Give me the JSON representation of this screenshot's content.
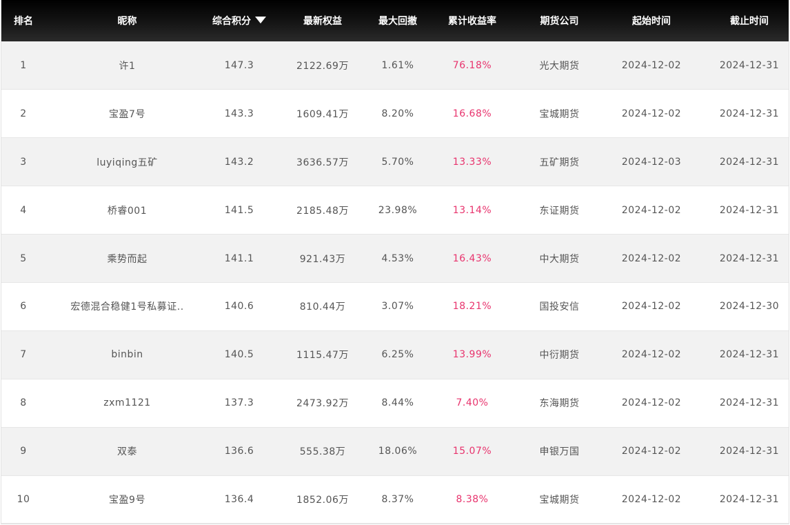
{
  "table": {
    "headers": {
      "rank": "排名",
      "nickname": "昵称",
      "score": "综合积分",
      "equity": "最新权益",
      "drawdown": "最大回撤",
      "return": "累计收益率",
      "company": "期货公司",
      "start": "起始时间",
      "end": "截止时间"
    },
    "sort_icon": "triangle-down-icon",
    "return_color": "#e8336d",
    "rows": [
      {
        "rank": "1",
        "nickname": "许1",
        "score": "147.3",
        "equity": "2122.69万",
        "drawdown": "1.61%",
        "return": "76.18%",
        "company": "光大期货",
        "start": "2024-12-02",
        "end": "2024-12-31"
      },
      {
        "rank": "2",
        "nickname": "宝盈7号",
        "score": "143.3",
        "equity": "1609.41万",
        "drawdown": "8.20%",
        "return": "16.68%",
        "company": "宝城期货",
        "start": "2024-12-02",
        "end": "2024-12-31"
      },
      {
        "rank": "3",
        "nickname": "luyiqing五矿",
        "score": "143.2",
        "equity": "3636.57万",
        "drawdown": "5.70%",
        "return": "13.33%",
        "company": "五矿期货",
        "start": "2024-12-03",
        "end": "2024-12-31"
      },
      {
        "rank": "4",
        "nickname": "桥睿001",
        "score": "141.5",
        "equity": "2185.48万",
        "drawdown": "23.98%",
        "return": "13.14%",
        "company": "东证期货",
        "start": "2024-12-02",
        "end": "2024-12-31"
      },
      {
        "rank": "5",
        "nickname": "乘势而起",
        "score": "141.1",
        "equity": "921.43万",
        "drawdown": "4.53%",
        "return": "16.43%",
        "company": "中大期货",
        "start": "2024-12-02",
        "end": "2024-12-31"
      },
      {
        "rank": "6",
        "nickname": "宏德混合稳健1号私募证..",
        "score": "140.6",
        "equity": "810.44万",
        "drawdown": "3.07%",
        "return": "18.21%",
        "company": "国投安信",
        "start": "2024-12-02",
        "end": "2024-12-30"
      },
      {
        "rank": "7",
        "nickname": "binbin",
        "score": "140.5",
        "equity": "1115.47万",
        "drawdown": "6.25%",
        "return": "13.99%",
        "company": "中衍期货",
        "start": "2024-12-02",
        "end": "2024-12-31"
      },
      {
        "rank": "8",
        "nickname": "zxm1121",
        "score": "137.3",
        "equity": "2473.92万",
        "drawdown": "8.44%",
        "return": "7.40%",
        "company": "东海期货",
        "start": "2024-12-02",
        "end": "2024-12-31"
      },
      {
        "rank": "9",
        "nickname": "双泰",
        "score": "136.6",
        "equity": "555.38万",
        "drawdown": "18.06%",
        "return": "15.07%",
        "company": "申银万国",
        "start": "2024-12-02",
        "end": "2024-12-31"
      },
      {
        "rank": "10",
        "nickname": "宝盈9号",
        "score": "136.4",
        "equity": "1852.06万",
        "drawdown": "8.37%",
        "return": "8.38%",
        "company": "宝城期货",
        "start": "2024-12-02",
        "end": "2024-12-31"
      }
    ]
  }
}
